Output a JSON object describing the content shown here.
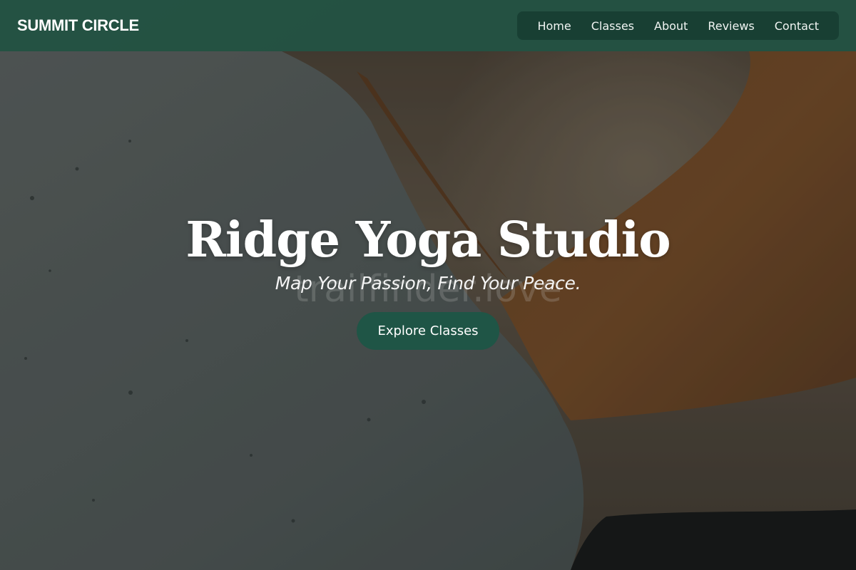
{
  "header": {
    "brand": "SUMMIT CIRCLE",
    "nav": [
      {
        "label": "Home"
      },
      {
        "label": "Classes"
      },
      {
        "label": "About"
      },
      {
        "label": "Reviews"
      },
      {
        "label": "Contact"
      }
    ]
  },
  "hero": {
    "title": "Ridge Yoga Studio",
    "tagline": "Map Your Passion, Find Your Peace.",
    "watermark": "trailfinder.love",
    "cta_label": "Explore Classes"
  },
  "colors": {
    "header_bg": "#215242",
    "button_bg": "#1f5546",
    "text": "#ffffff"
  }
}
